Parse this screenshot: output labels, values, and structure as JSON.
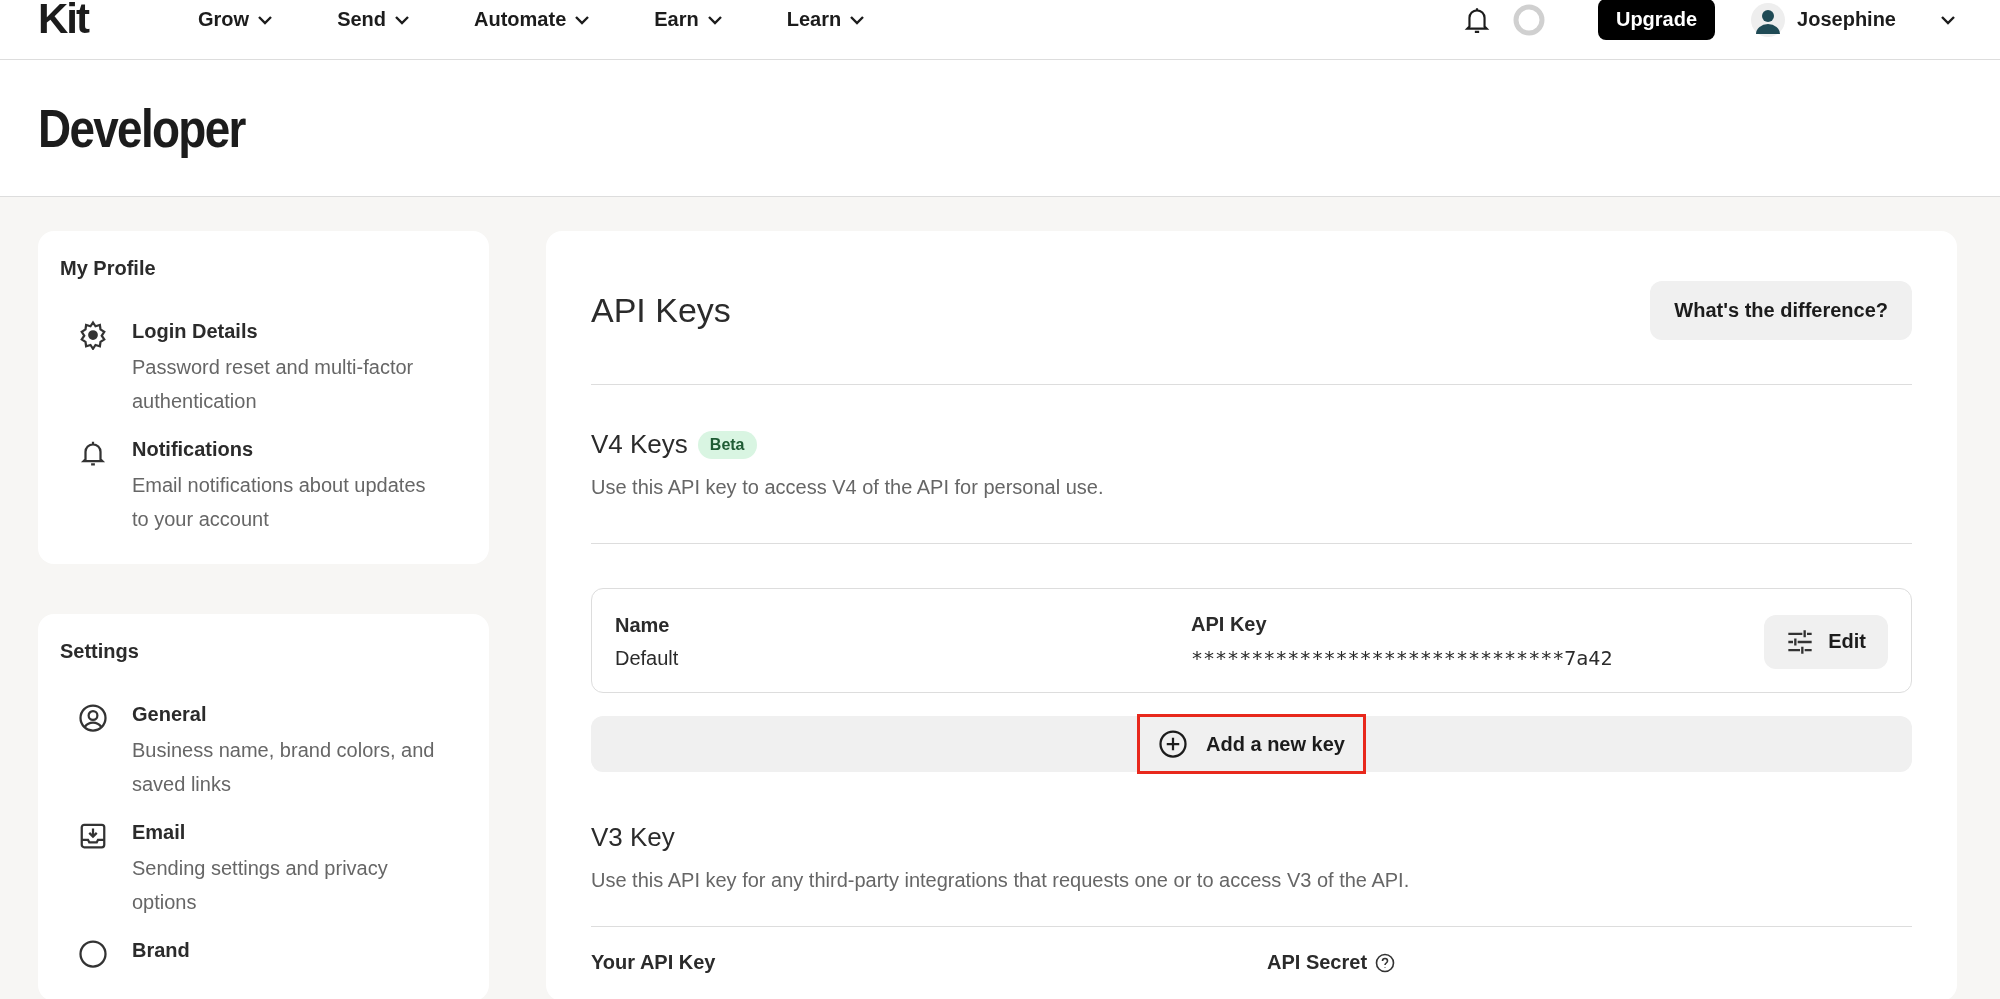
{
  "nav": {
    "logo": "Kit",
    "menus": [
      {
        "label": "Grow"
      },
      {
        "label": "Send"
      },
      {
        "label": "Automate"
      },
      {
        "label": "Earn"
      },
      {
        "label": "Learn"
      }
    ],
    "upgrade": "Upgrade",
    "user": "Josephine"
  },
  "page_title": "Developer",
  "sidebar": [
    {
      "heading": "My Profile",
      "items": [
        {
          "title": "Login Details",
          "description": "Password reset and multi-factor authentication"
        },
        {
          "title": "Notifications",
          "description": "Email notifications about updates to your account"
        }
      ]
    },
    {
      "heading": "Settings",
      "items": [
        {
          "title": "General",
          "description": "Business name, brand colors, and saved links"
        },
        {
          "title": "Email",
          "description": "Sending settings and privacy options"
        },
        {
          "title": "Brand"
        }
      ]
    }
  ],
  "main": {
    "title": "API Keys",
    "help_button": "What's the difference?",
    "v4": {
      "title": "V4 Keys",
      "badge": "Beta",
      "description": "Use this API key to access V4 of the API for personal use.",
      "columns": [
        "Name",
        "API Key"
      ],
      "keys": [
        {
          "name": "Default",
          "key": "*******************************7a42"
        }
      ],
      "edit_button": "Edit",
      "add_button": {
        "label": "Add a new key",
        "highlighted": true
      }
    },
    "v3": {
      "title": "V3 Key",
      "description": "Use this API key for any third-party integrations that requests one or to access V3 of the API.",
      "fields": [
        "Your API Key",
        "API Secret"
      ]
    }
  }
}
